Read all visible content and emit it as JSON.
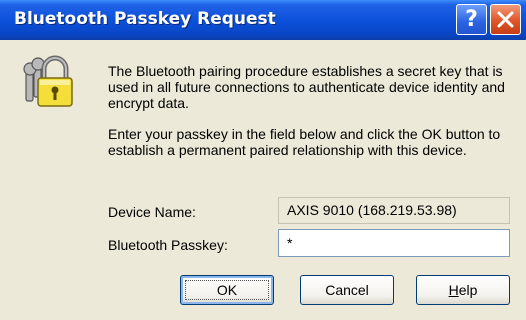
{
  "window": {
    "title": "Bluetooth Passkey Request",
    "help_glyph": "?",
    "icons": {
      "help": "question-mark-icon",
      "close": "close-x-icon",
      "main": "padlock-keys-icon"
    }
  },
  "message": {
    "paragraph1": "The Bluetooth pairing procedure establishes a secret key that is used in all future connections to authenticate device identity and encrypt data.",
    "paragraph2": "Enter your passkey in the field below and click the OK button to establish a permanent paired relationship with this device."
  },
  "form": {
    "device_name_label": "Device Name:",
    "device_name_value": "AXIS 9010 (168.219.53.98)",
    "passkey_label": "Bluetooth Passkey:",
    "passkey_value": "*"
  },
  "buttons": {
    "ok": "OK",
    "cancel": "Cancel",
    "help_first": "H",
    "help_rest": "elp"
  },
  "colors": {
    "titlebar": "#0b4fd8",
    "dialog_bg": "#ece9d8",
    "close_button": "#e0552a",
    "button_border": "#003c74"
  }
}
